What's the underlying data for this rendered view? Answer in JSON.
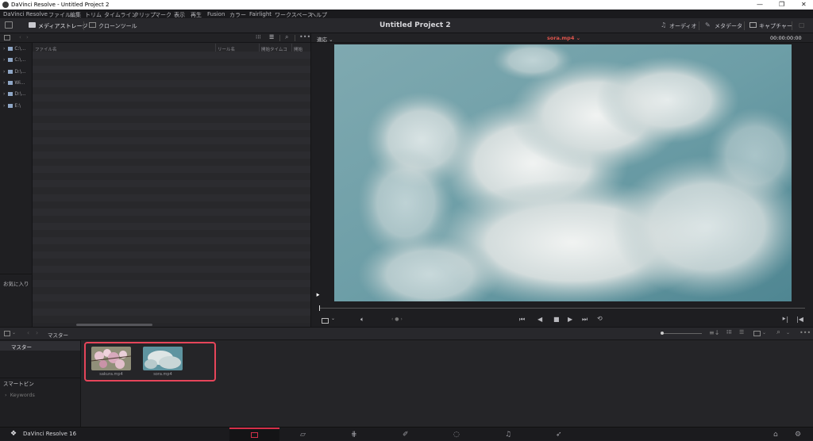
{
  "window": {
    "title": "DaVinci Resolve - Untitled Project 2",
    "minimize": "—",
    "maximize": "❐",
    "close": "✕"
  },
  "menu": [
    "DaVinci Resolve",
    "ファイル",
    "編集",
    "トリム",
    "タイムライン",
    "クリップ",
    "マーク",
    "表示",
    "再生",
    "Fusion",
    "カラー",
    "Fairlight",
    "ワークスペース",
    "ヘルプ"
  ],
  "toolbar": {
    "media_storage": "メディアストレージ",
    "clone_tool": "クローンツール",
    "project_title": "Untitled Project 2",
    "audio": "オーディオ",
    "metadata": "メタデータ",
    "capture": "キャプチャー"
  },
  "media_storage": {
    "columns": [
      "ファイル名",
      "リール名",
      "開始タイムコ",
      "開始"
    ],
    "drives": [
      "C:\\...",
      "C:\\...",
      "D:\\...",
      "Wi...",
      "D:\\...",
      "E:\\"
    ],
    "favorites_label": "お気に入り"
  },
  "viewer": {
    "zoom": "適応",
    "clip_name": "sora.mp4",
    "timecode": "00:00:00:00",
    "clip_name_color": "#e0554d"
  },
  "bins": {
    "path": "マスター",
    "master": "マスター",
    "smart_bins": "スマートビン",
    "keywords": "Keywords",
    "clips": [
      {
        "name": "sakura.mp4",
        "icon": "cherry-blossom-thumbnail"
      },
      {
        "name": "sora.mp4",
        "icon": "clouds-thumbnail"
      }
    ]
  },
  "pagebar": {
    "app_name": "DaVinci Resolve 16",
    "pages": [
      "media-page-icon",
      "cut-page-icon",
      "edit-page-icon",
      "fusion-page-icon",
      "color-page-icon",
      "fairlight-page-icon",
      "deliver-page-icon"
    ]
  },
  "colors": {
    "accent": "#e6455a",
    "active_page": "#d4304a"
  }
}
